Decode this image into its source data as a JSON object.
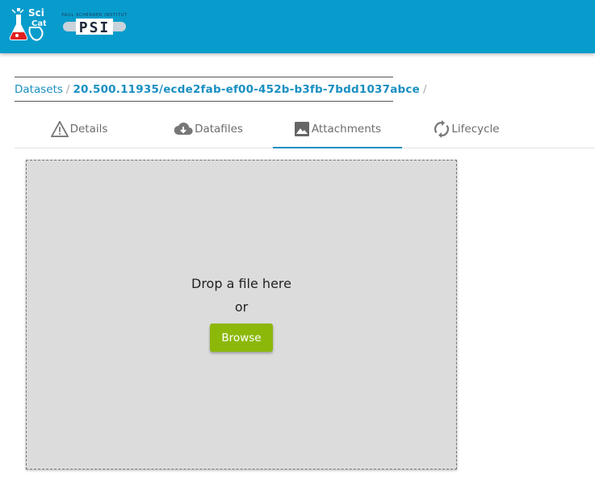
{
  "header": {
    "scicat_logo_text_top": "Sci",
    "scicat_logo_text_bottom": "Cat",
    "psi_logo_tagline": "PAUL SCHERRER INSTITUT",
    "psi_logo_text": "PSI",
    "background_color": "#079ccc"
  },
  "breadcrumb": {
    "root_label": "Datasets",
    "separator": "/",
    "dataset_id": "20.500.11935/ecde2fab-ef00-452b-b3fb-7bdd1037abce",
    "trailing_separator": "/"
  },
  "tabs": [
    {
      "label": "Details",
      "icon": "warning-icon",
      "active": false
    },
    {
      "label": "Datafiles",
      "icon": "cloud-download-icon",
      "active": false
    },
    {
      "label": "Attachments",
      "icon": "image-icon",
      "active": true
    },
    {
      "label": "Lifecycle",
      "icon": "sync-icon",
      "active": false
    }
  ],
  "dropzone": {
    "drop_text": "Drop a file here",
    "or_text": "or",
    "browse_label": "Browse",
    "button_color": "#8cb80a"
  },
  "accent_color": "#1a8fc1"
}
